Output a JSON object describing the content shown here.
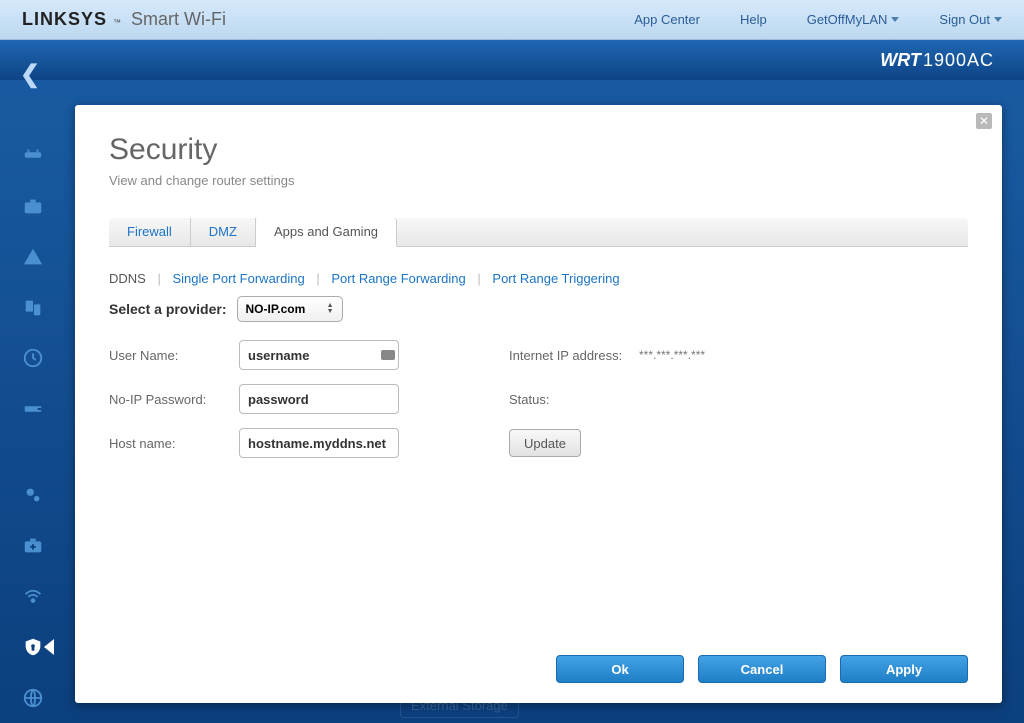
{
  "header": {
    "brand": "LINKSYS",
    "brand_sub": "Smart Wi-Fi",
    "nav": {
      "app_center": "App Center",
      "help": "Help",
      "account": "GetOffMyLAN",
      "sign_out": "Sign Out"
    },
    "model_prefix": "WRT",
    "model_rest": "1900AC"
  },
  "panel": {
    "title": "Security",
    "subtitle": "View and change router settings",
    "tabs": [
      "Firewall",
      "DMZ",
      "Apps and Gaming"
    ],
    "subnav": [
      "DDNS",
      "Single Port Forwarding",
      "Port Range Forwarding",
      "Port Range Triggering"
    ],
    "provider_label": "Select a provider:",
    "provider_value": "NO-IP.com",
    "form": {
      "username_label": "User Name:",
      "username_value": "username",
      "password_label": "No-IP Password:",
      "password_value": "password",
      "host_label": "Host name:",
      "host_value": "hostname.myddns.net",
      "ip_label": "Internet IP address:",
      "ip_value": "***.***.***.***",
      "status_label": "Status:",
      "update_label": "Update"
    },
    "buttons": {
      "ok": "Ok",
      "cancel": "Cancel",
      "apply": "Apply"
    }
  },
  "ghost": "External Storage"
}
